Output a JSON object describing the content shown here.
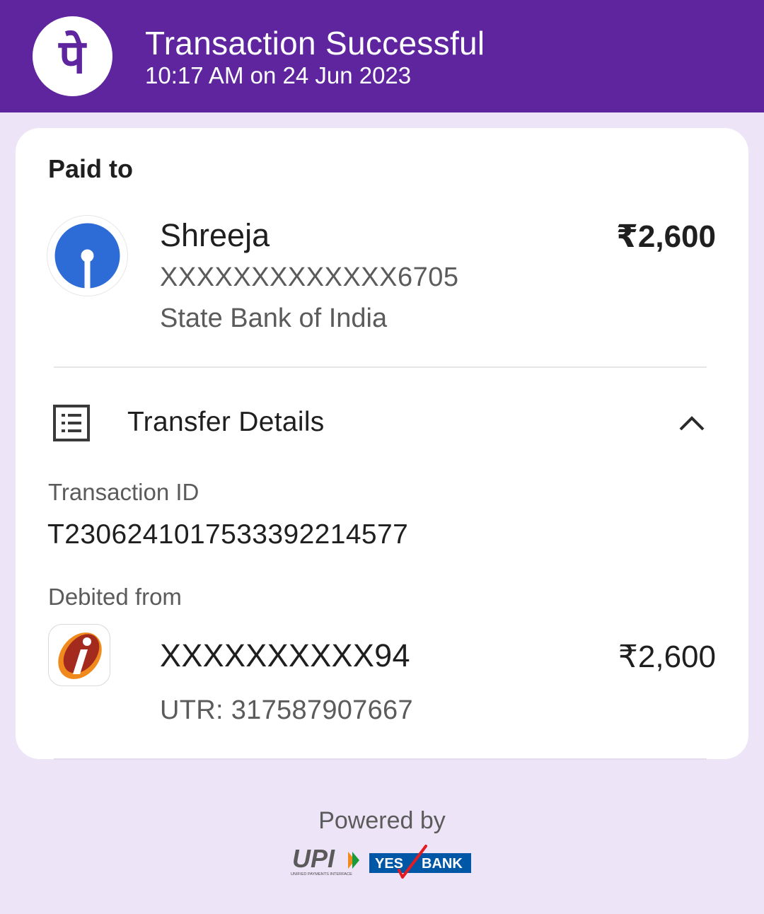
{
  "header": {
    "title": "Transaction Successful",
    "subtitle": "10:17 AM on 24 Jun 2023",
    "logo_glyph": "पे",
    "logo_icon": "phonepe-logo-icon"
  },
  "paid_to": {
    "label": "Paid to",
    "name": "Shreeja",
    "account": "XXXXXXXXXXXXX6705",
    "bank": "State Bank of India",
    "amount": "₹2,600",
    "bank_icon": "sbi-logo-icon"
  },
  "transfer_details": {
    "title": "Transfer Details",
    "icon": "list-document-icon",
    "toggle_icon": "chevron-up-icon",
    "transaction_id_label": "Transaction ID",
    "transaction_id": "T2306241017533392214577",
    "debited_from_label": "Debited from",
    "debit_account": "XXXXXXXXXX94",
    "debit_amount": "₹2,600",
    "utr": "UTR: 317587907667",
    "debit_bank_icon": "icici-logo-icon"
  },
  "footer": {
    "powered_by": "Powered by",
    "upi_logo_text": "UPI",
    "upi_tagline": "UNIFIED PAYMENTS INTERFACE",
    "yes_bank_text_1": "YES",
    "yes_bank_text_2": "BANK"
  },
  "colors": {
    "brand_purple": "#5f259f",
    "page_background": "#ede4f7",
    "sbi_blue": "#2d6bd6",
    "icici_orange": "#f08a1c",
    "icici_maroon": "#a52a1e",
    "yes_bank_blue": "#0057a6",
    "yes_bank_red": "#e31b23"
  }
}
